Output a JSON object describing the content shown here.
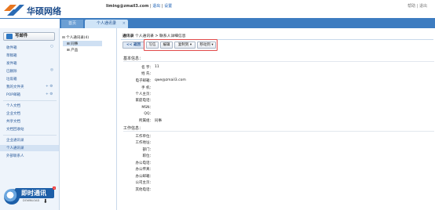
{
  "header": {
    "brand": "华硕网络",
    "user_email": "liming@zmail3.com",
    "sep1": "|",
    "logout": "退出",
    "sep2": "|",
    "settings": "设置",
    "help": "帮助",
    "sep3": "|",
    "sign_out": "退出"
  },
  "tabs": [
    {
      "label": "首页"
    },
    {
      "label": "个人通讯录",
      "close": "×"
    }
  ],
  "sidebar": {
    "compose": "写邮件",
    "items": [
      {
        "label": "收件箱"
      },
      {
        "label": "草稿箱"
      },
      {
        "label": "发件箱"
      },
      {
        "label": "已删除"
      },
      {
        "label": "垃圾箱"
      },
      {
        "label": "我的文件夹"
      },
      {
        "label": "POP邮箱"
      },
      {
        "label": "个人文档"
      },
      {
        "label": "企业文档"
      },
      {
        "label": "共享文档"
      },
      {
        "label": "文档回收站"
      },
      {
        "label": "企业通讯录"
      },
      {
        "label": "个人通讯录"
      },
      {
        "label": "外部联系人"
      }
    ],
    "folder_controls": "+ ⚙",
    "pop_controls": "+ ⚙"
  },
  "im_widget": {
    "title": "即时通讯",
    "sub": "DOWNLOAD",
    "close": "×"
  },
  "tree": {
    "root": "个人通讯录(4)",
    "children": [
      "同事",
      "产品"
    ]
  },
  "breadcrumb": {
    "current": "通讯录",
    "path": "个人通讯录 > 联系人详细信息"
  },
  "toolbar": {
    "back": "<< 返回",
    "reply": "写信",
    "edit": "编辑",
    "copy": "复制到 ▾",
    "move": "移动到 ▾"
  },
  "basic": {
    "heading": "基本信息：",
    "fields": [
      {
        "label": "名 字：",
        "value": "11"
      },
      {
        "label": "姓 氏：",
        "value": ""
      },
      {
        "label": "电子邮箱：",
        "value": "qwe@zmail3.com"
      },
      {
        "label": "手 机：",
        "value": ""
      },
      {
        "label": "个人主页：",
        "value": ""
      },
      {
        "label": "家庭电话：",
        "value": ""
      },
      {
        "label": "MSN：",
        "value": ""
      },
      {
        "label": "QQ：",
        "value": ""
      },
      {
        "label": "所属组：",
        "value": "同事"
      }
    ]
  },
  "work": {
    "heading": "工作信息：",
    "fields": [
      {
        "label": "工作单位：",
        "value": ""
      },
      {
        "label": "工作地址：",
        "value": ""
      },
      {
        "label": "部门：",
        "value": ""
      },
      {
        "label": "职位：",
        "value": ""
      },
      {
        "label": "办公电话：",
        "value": ""
      },
      {
        "label": "办公传真：",
        "value": ""
      },
      {
        "label": "办公邮箱：",
        "value": ""
      },
      {
        "label": "公司主页：",
        "value": ""
      },
      {
        "label": "其他电话：",
        "value": ""
      }
    ]
  },
  "colors": {
    "accent": "#3d7cc0",
    "highlight": "#e24a4a"
  }
}
